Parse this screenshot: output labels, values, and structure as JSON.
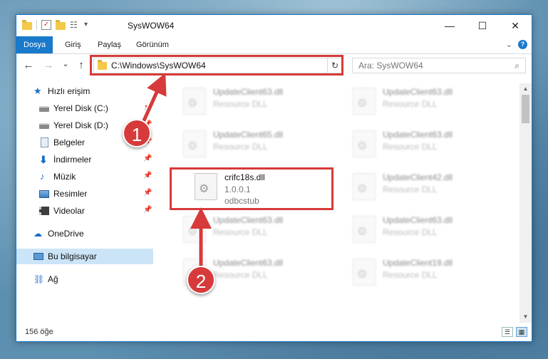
{
  "title": "SysWOW64",
  "window_controls": {
    "minimize": "—",
    "maximize": "☐",
    "close": "✕"
  },
  "ribbon": {
    "tabs": [
      {
        "label": "Dosya",
        "active": true
      },
      {
        "label": "Giriş",
        "active": false
      },
      {
        "label": "Paylaş",
        "active": false
      },
      {
        "label": "Görünüm",
        "active": false
      }
    ],
    "expand": "⌄",
    "help": "?"
  },
  "nav": {
    "back": "←",
    "forward": "→",
    "recent": "⌄",
    "up": "↑"
  },
  "address": {
    "path": "C:\\Windows\\SysWOW64",
    "dropdown": "⌄",
    "refresh": "↻"
  },
  "search": {
    "placeholder": "Ara: SysWOW64",
    "icon": "⌕"
  },
  "sidebar": {
    "items": [
      {
        "label": "Hızlı erişim",
        "icon": "star-icon",
        "glyph": "★",
        "pinned": false
      },
      {
        "label": "Yerel Disk (C:)",
        "icon": "disk-icon",
        "glyph": "",
        "pinned": true
      },
      {
        "label": "Yerel Disk (D:)",
        "icon": "disk-icon",
        "glyph": "",
        "pinned": true
      },
      {
        "label": "Belgeler",
        "icon": "document-icon",
        "glyph": "",
        "pinned": true
      },
      {
        "label": "İndirmeler",
        "icon": "download-icon",
        "glyph": "⬇",
        "pinned": true
      },
      {
        "label": "Müzik",
        "icon": "music-icon",
        "glyph": "♪",
        "pinned": true
      },
      {
        "label": "Resimler",
        "icon": "pictures-icon",
        "glyph": "",
        "pinned": true
      },
      {
        "label": "Videolar",
        "icon": "video-icon",
        "glyph": "",
        "pinned": true
      },
      {
        "label": "OneDrive",
        "icon": "cloud-icon",
        "glyph": "☁",
        "pinned": false
      },
      {
        "label": "Bu bilgisayar",
        "icon": "computer-icon",
        "glyph": "",
        "pinned": false,
        "selected": true
      },
      {
        "label": "Ağ",
        "icon": "network-icon",
        "glyph": "⛓",
        "pinned": false
      }
    ],
    "pin_glyph": "📌"
  },
  "files": [
    {
      "name": "UpdateClient63.dll",
      "line1": "Resource DLL",
      "line2": "",
      "faded": true
    },
    {
      "name": "UpdateClient63.dll",
      "line1": "Resource DLL",
      "line2": "",
      "faded": true
    },
    {
      "name": "UpdateClient65.dll",
      "line1": "Resource DLL",
      "line2": "",
      "faded": true
    },
    {
      "name": "UpdateClient63.dll",
      "line1": "Resource DLL",
      "line2": "",
      "faded": true
    },
    {
      "name": "crifc18s.dll",
      "line1": "1.0.0.1",
      "line2": "odbcstub",
      "faded": false
    },
    {
      "name": "UpdateClient42.dll",
      "line1": "Resource DLL",
      "line2": "",
      "faded": true
    },
    {
      "name": "UpdateClient63.dll",
      "line1": "Resource DLL",
      "line2": "",
      "faded": true
    },
    {
      "name": "UpdateClient63.dll",
      "line1": "Resource DLL",
      "line2": "",
      "faded": true
    },
    {
      "name": "UpdateClient63.dll",
      "line1": "Resource DLL",
      "line2": "",
      "faded": true
    },
    {
      "name": "UpdateClient19.dll",
      "line1": "Resource DLL",
      "line2": "",
      "faded": true
    }
  ],
  "status": {
    "count": "156 öğe",
    "details_view": "☰",
    "tiles_view": "▦"
  },
  "scrollbar": {
    "up": "▲",
    "down": "▼"
  },
  "annotations": {
    "step1": "1",
    "step2": "2",
    "accent": "#d63a3a"
  }
}
